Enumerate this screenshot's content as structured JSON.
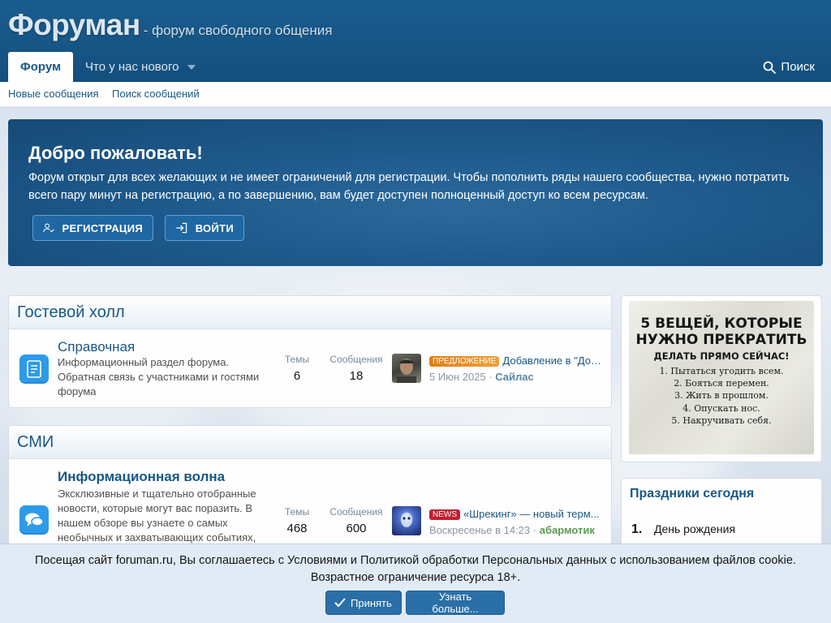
{
  "header": {
    "logo": "Форуман",
    "tagline": "- форум свободного общения",
    "nav": {
      "active_tab": "Форум",
      "whats_new": "Что у нас нового",
      "search": "Поиск"
    }
  },
  "subnav": {
    "new_posts": "Новые сообщения",
    "search_posts": "Поиск сообщений"
  },
  "welcome": {
    "title": "Добро пожаловать!",
    "text": "Форум открыт для всех желающих и не имеет ограничений для регистрации. Чтобы пополнить ряды нашего сообщества, нужно потратить всего пару минут на регистрацию, а по завершению, вам будет доступен полноценный доступ ко всем ресурсам.",
    "register": "РЕГИСТРАЦИЯ",
    "login": "ВОЙТИ"
  },
  "categories": [
    {
      "title": "Гостевой холл",
      "node": {
        "title": "Справочная",
        "desc": "Информационный раздел форума. Обратная связь с участниками и гостями форума",
        "threads_label": "Темы",
        "threads": "6",
        "posts_label": "Сообщения",
        "posts": "18",
        "last_prefix": "ПРЕДЛОЖЕНИЕ",
        "last_title": "Добавление в \"Дос...",
        "last_date": "5 Июн 2025",
        "last_sep": "·",
        "last_user": "Сайлас"
      }
    },
    {
      "title": "СМИ",
      "node": {
        "title": "Информационная волна",
        "desc": "Эксклюзивные и тщательно отобранные новости, которые могут вас поразить. В нашем обзоре вы узнаете о самых необычных и захватывающих событиях,",
        "threads_label": "Темы",
        "threads": "468",
        "posts_label": "Сообщения",
        "posts": "600",
        "last_prefix": "NEWS",
        "last_title": "«Шрекинг» — новый терм...",
        "last_date": "Воскресенье в 14:23",
        "last_sep": "·",
        "last_user": "абармотик"
      }
    }
  ],
  "sidebar": {
    "poster": {
      "line1": "5 ВЕЩЕЙ, КОТОРЫЕ",
      "line2": "НУЖНО ПРЕКРАТИТЬ",
      "line3": "ДЕЛАТЬ ПРЯМО СЕЙЧАС!",
      "items": [
        "1. Пытаться угодить всем.",
        "2. Бояться перемен.",
        "3. Жить в прошлом.",
        "4. Опускать нос.",
        "5. Накручивать себя."
      ]
    },
    "holidays": {
      "title": "Праздники сегодня",
      "first_num": "1.",
      "first_text": "День рождения"
    }
  },
  "cookie": {
    "text1": "Посещая сайт foruman.ru, Вы соглашаетесь с Условиями и Политикой обработки Персональных данных с использованием файлов cookie.",
    "text2": "Возрастное ограничение ресурса 18+.",
    "accept": "Принять",
    "more": "Узнать больше..."
  },
  "colors": {
    "brand": "#185886",
    "prefix_offer": "#e8871e",
    "prefix_news": "#c0202e",
    "user_green": "#5b9a52"
  }
}
